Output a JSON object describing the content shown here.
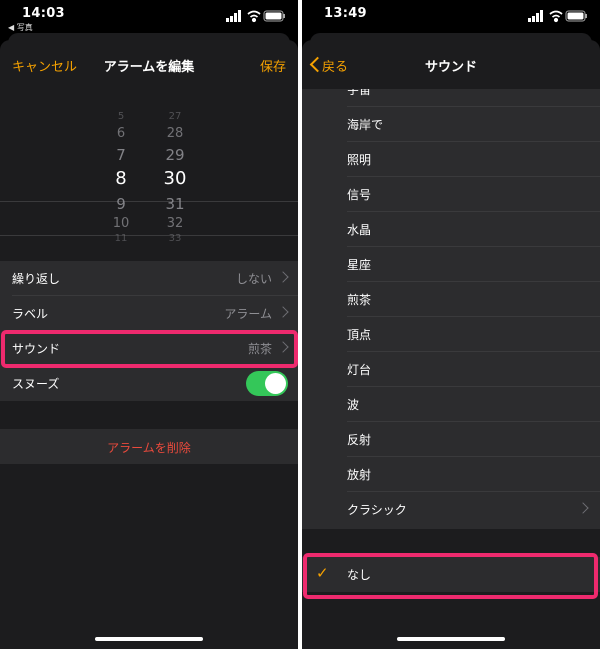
{
  "left": {
    "status_time": "14:03",
    "back_app": "◀ 写真",
    "nav": {
      "cancel": "キャンセル",
      "title": "アラームを編集",
      "save": "保存"
    },
    "picker": {
      "hours": [
        "5",
        "6",
        "7",
        "8",
        "9",
        "10",
        "11"
      ],
      "minutes": [
        "27",
        "28",
        "29",
        "30",
        "31",
        "32",
        "33"
      ],
      "selected_hour": "8",
      "selected_minute": "30"
    },
    "rows": [
      {
        "label": "繰り返し",
        "value": "しない"
      },
      {
        "label": "ラベル",
        "value": "アラーム"
      },
      {
        "label": "サウンド",
        "value": "煎茶"
      },
      {
        "label": "スヌーズ",
        "value": ""
      }
    ],
    "snooze_on": true,
    "delete": "アラームを削除"
  },
  "right": {
    "status_time": "13:49",
    "nav": {
      "back": "戻る",
      "title": "サウンド"
    },
    "sounds": [
      "宇宙",
      "海岸で",
      "照明",
      "信号",
      "水晶",
      "星座",
      "煎茶",
      "頂点",
      "灯台",
      "波",
      "反射",
      "放射",
      "クラシック"
    ],
    "none_label": "なし",
    "selected": "なし"
  },
  "colors": {
    "accent": "#f5a100",
    "highlight": "#ee2a6e",
    "toggle_on": "#34c759",
    "destructive": "#eb4a3c"
  }
}
